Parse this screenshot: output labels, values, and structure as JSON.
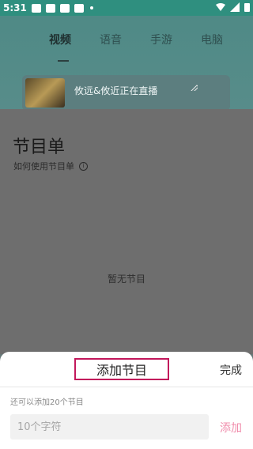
{
  "status_bar": {
    "time": "5:31"
  },
  "top_tabs": {
    "items": [
      "视频",
      "语音",
      "手游",
      "电脑"
    ]
  },
  "live_card": {
    "title": "攸远&攸近正在直播"
  },
  "program_list": {
    "title": "节目单",
    "help": "如何使用节目单",
    "empty": "暂无节目"
  },
  "sheet": {
    "title": "添加节目",
    "done": "完成",
    "hint": "还可以添加20个节目",
    "input_placeholder": "10个字符",
    "input_value": "",
    "add": "添加"
  },
  "colors": {
    "accent_pink": "#f08cab",
    "highlight_box": "#c2185b"
  }
}
